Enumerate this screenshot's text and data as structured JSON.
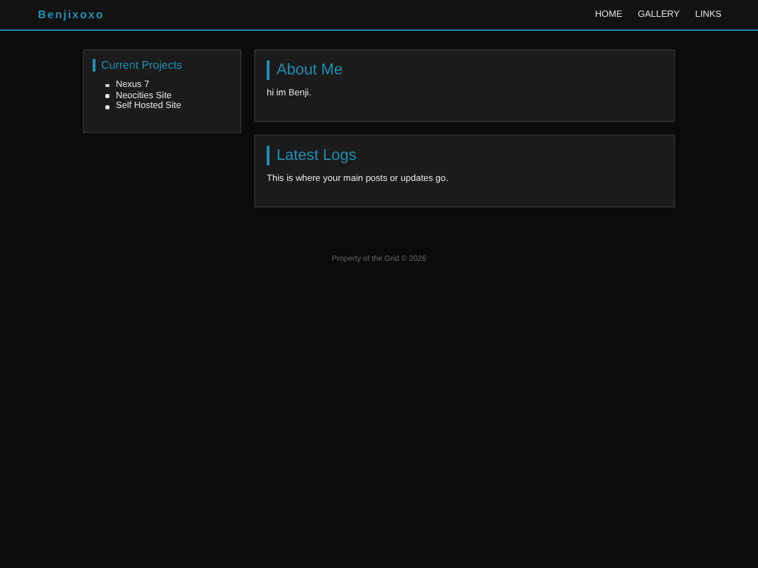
{
  "header": {
    "logo": "Benjixoxo",
    "nav": [
      "HOME",
      "GALLERY",
      "LINKS"
    ]
  },
  "sidebar": {
    "title": "Current Projects",
    "items": [
      "Nexus 7",
      "Neocities Site",
      "Self Hosted Site"
    ]
  },
  "sections": [
    {
      "title": "About Me",
      "text": "hi im Benji."
    },
    {
      "title": "Latest Logs",
      "text": "This is where your main posts or updates go."
    }
  ],
  "footer": "Property of the Grid © 2026"
}
